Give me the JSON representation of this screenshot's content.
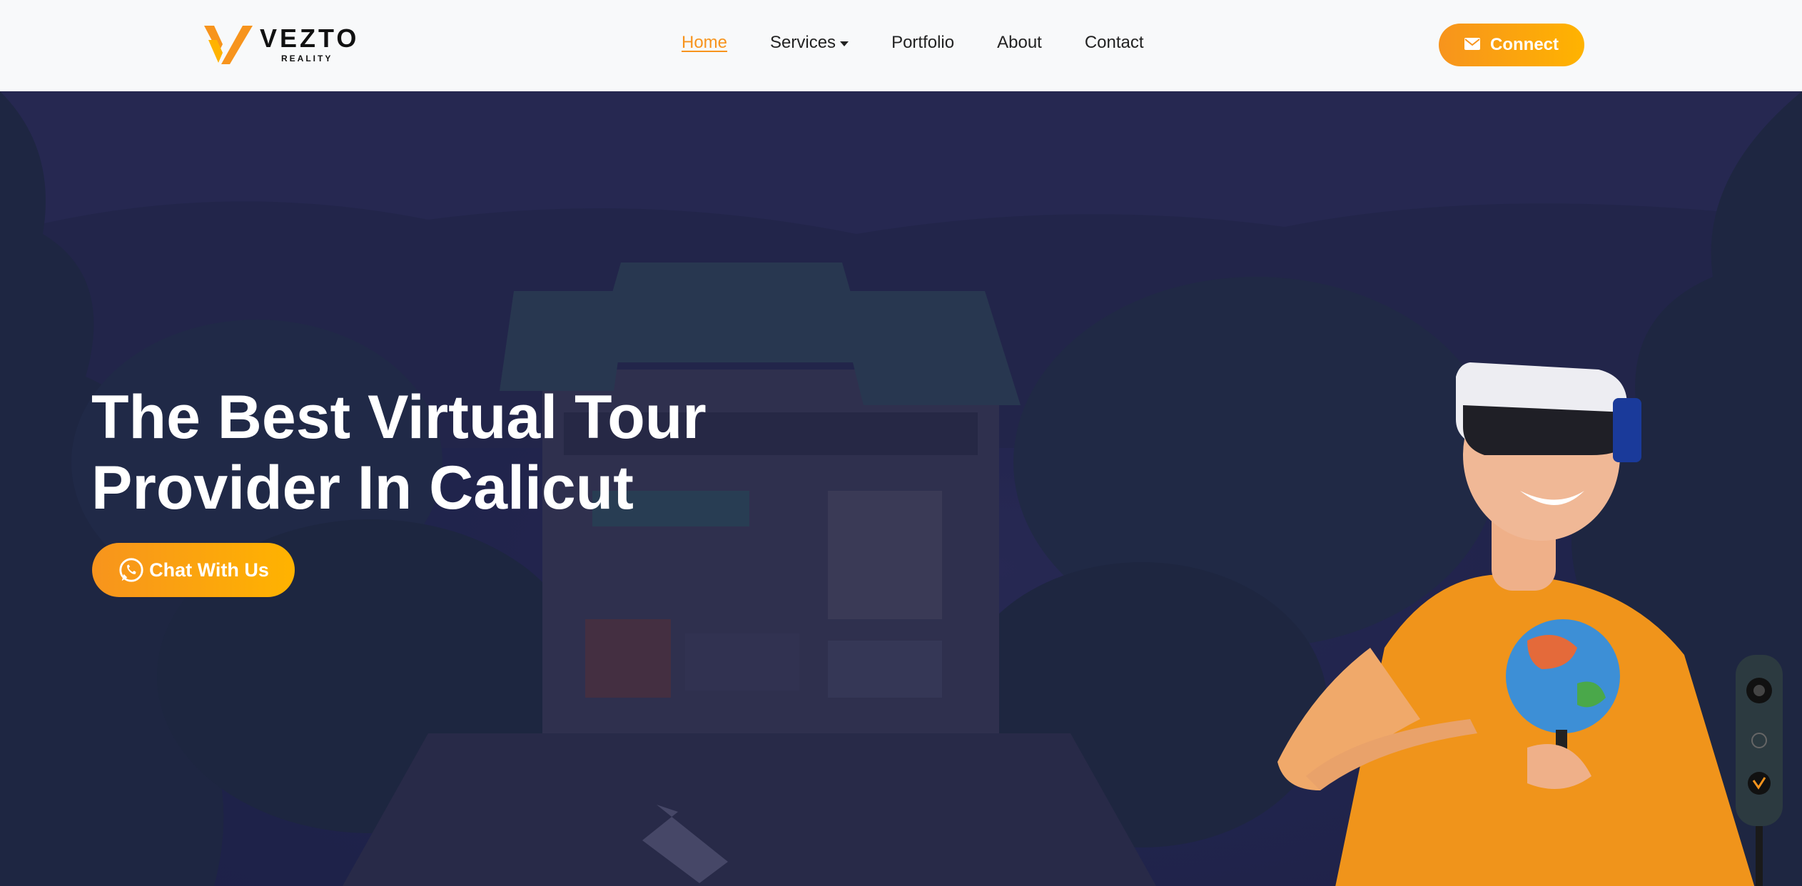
{
  "brand": {
    "name": "VEZTO",
    "sub": "REALITY"
  },
  "nav": {
    "items": [
      {
        "label": "Home",
        "active": true
      },
      {
        "label": "Services",
        "has_dropdown": true
      },
      {
        "label": "Portfolio"
      },
      {
        "label": "About"
      },
      {
        "label": "Contact"
      }
    ]
  },
  "connect_button": {
    "label": "Connect",
    "icon": "mail-icon"
  },
  "hero": {
    "title_line1": "The Best Virtual Tour",
    "title_line2": "Provider In Calicut",
    "cta_label": "Chat With Us",
    "cta_icon": "whatsapp-icon"
  },
  "colors": {
    "accent": "#f7941d",
    "accent_end": "#ffb300",
    "hero_overlay": "#23284a"
  }
}
